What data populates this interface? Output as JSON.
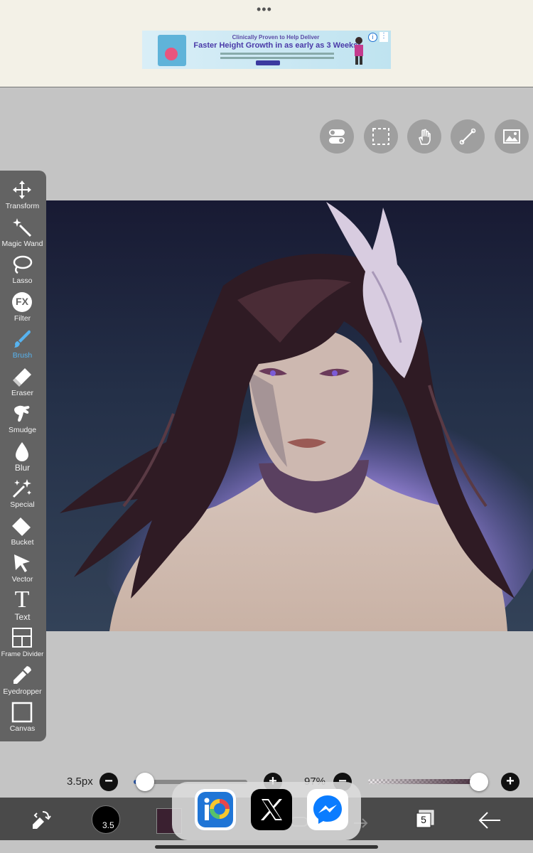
{
  "ad": {
    "dots": "•••",
    "headline_small": "Clinically Proven to Help Deliver",
    "headline_big": "Faster Height Growth in as early as 3 Weeks*",
    "info": "i",
    "more": "⋮"
  },
  "top_tools": [
    {
      "name": "toggle-settings-icon"
    },
    {
      "name": "selection-icon"
    },
    {
      "name": "hand-icon"
    },
    {
      "name": "ruler-icon"
    },
    {
      "name": "image-icon"
    }
  ],
  "toolbar": {
    "items": [
      {
        "label": "Transform",
        "icon": "move-arrows-icon"
      },
      {
        "label": "Magic Wand",
        "icon": "magic-wand-icon"
      },
      {
        "label": "Lasso",
        "icon": "lasso-icon"
      },
      {
        "label": "Filter",
        "icon": "fx-icon"
      },
      {
        "label": "Brush",
        "icon": "brush-icon"
      },
      {
        "label": "Eraser",
        "icon": "eraser-icon"
      },
      {
        "label": "Smudge",
        "icon": "smudge-icon"
      },
      {
        "label": "Blur",
        "icon": "droplet-icon"
      },
      {
        "label": "Special",
        "icon": "sparkles-icon"
      },
      {
        "label": "Bucket",
        "icon": "bucket-icon"
      },
      {
        "label": "Vector",
        "icon": "cursor-arrow-icon"
      },
      {
        "label": "Text",
        "icon": "text-t-icon"
      },
      {
        "label": "Frame Divider",
        "icon": "frame-divider-icon"
      },
      {
        "label": "Eyedropper",
        "icon": "eyedropper-icon"
      },
      {
        "label": "Canvas",
        "icon": "canvas-icon"
      }
    ],
    "active": "Brush",
    "fx_glyph": "FX",
    "text_glyph": "T"
  },
  "controls": {
    "brush_size_label": "3.5px",
    "size_slider_fraction": 0.1,
    "zoom_label": "97%",
    "opacity_slider_fraction": 0.93,
    "minus": "−",
    "plus": "+"
  },
  "bottom_bar": {
    "brush_size_text": "3.5",
    "layer_count": "5",
    "color": "#3a2030"
  },
  "dock": {
    "apps": [
      {
        "name": "ibispaint-app-icon",
        "glyph": "iP"
      },
      {
        "name": "x-app-icon",
        "glyph": "X"
      },
      {
        "name": "messenger-app-icon",
        "glyph": "⚡"
      }
    ]
  },
  "colors": {
    "active_tool": "#57b3f0",
    "toolbar_bg": "#636363",
    "canvas_bg": "#c4c4c4"
  }
}
